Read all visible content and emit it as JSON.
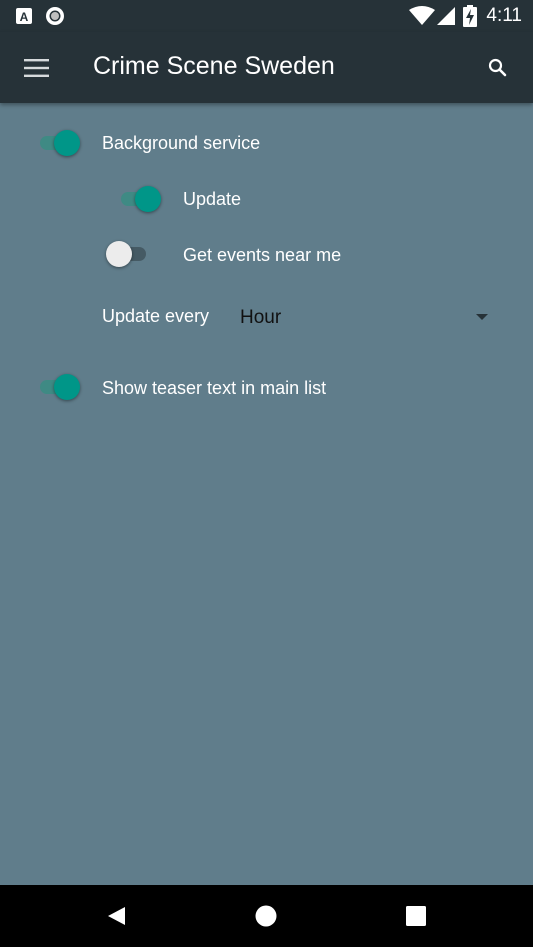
{
  "status_bar": {
    "time": "4:11",
    "icons": [
      "a-notification-icon",
      "circle-notification-icon",
      "wifi-icon",
      "signal-icon",
      "battery-charging-icon"
    ]
  },
  "app_bar": {
    "title": "Crime Scene Sweden",
    "menu_icon": "hamburger-menu-icon",
    "search_icon": "search-icon"
  },
  "settings": {
    "background_service": {
      "label": "Background service",
      "enabled": true
    },
    "update": {
      "label": "Update",
      "enabled": true
    },
    "events_near_me": {
      "label": "Get events near me",
      "enabled": false
    },
    "update_every": {
      "label": "Update every",
      "value": "Hour"
    },
    "teaser_text": {
      "label": "Show teaser text in main list",
      "enabled": true
    }
  },
  "nav_bar": {
    "icons": [
      "back-icon",
      "home-icon",
      "recents-icon"
    ]
  },
  "colors": {
    "background": "#607d8b",
    "app_bar": "#263238",
    "accent": "#009688",
    "nav_bar": "#000000"
  }
}
